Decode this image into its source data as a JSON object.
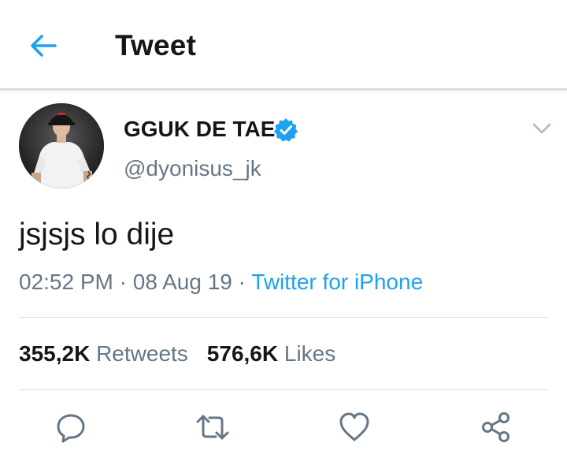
{
  "header": {
    "title": "Tweet",
    "back_icon": "arrow-left-icon"
  },
  "tweet": {
    "display_name": "GGUK DE TAE",
    "handle": "@dyonisus_jk",
    "verified": true,
    "text": "jsjsjs lo dije",
    "time": "02:52 PM",
    "separator": " · ",
    "date": "08 Aug 19",
    "source": "Twitter for iPhone"
  },
  "stats": {
    "retweets_count": "355,2K",
    "retweets_label": "Retweets",
    "likes_count": "576,6K",
    "likes_label": "Likes"
  },
  "actions": [
    "reply-icon",
    "retweet-icon",
    "like-icon",
    "share-icon"
  ],
  "colors": {
    "accent": "#1da1f2",
    "secondary_text": "#657786",
    "icon_gray": "#657786",
    "divider": "#d9dde0"
  }
}
